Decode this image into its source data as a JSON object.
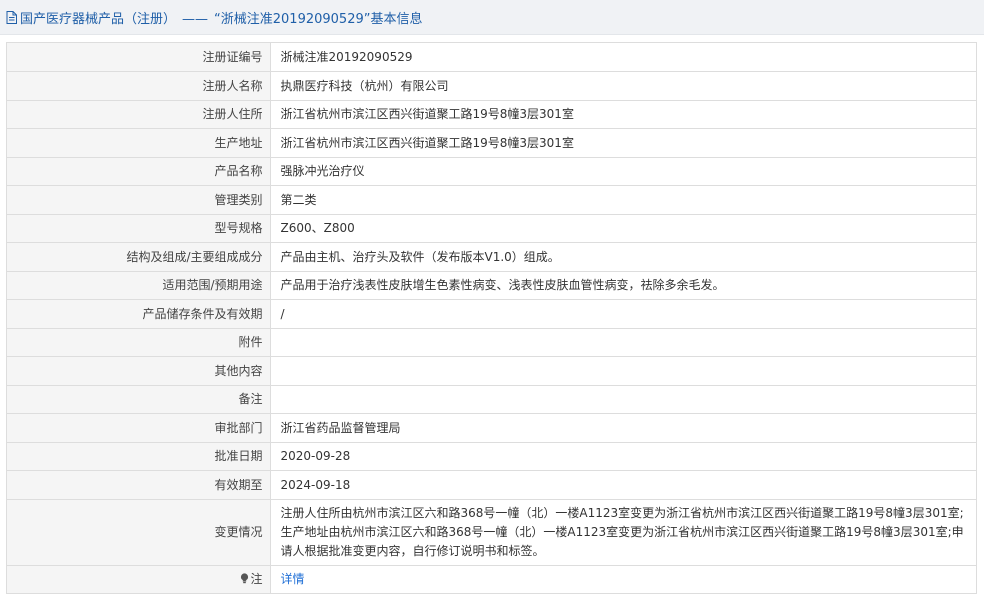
{
  "header": {
    "category": "国产医疗器械产品（注册）",
    "separator": "——",
    "record_title": "“浙械注准20192090529”基本信息"
  },
  "rows": [
    {
      "label": "注册证编号",
      "value": "浙械注准20192090529"
    },
    {
      "label": "注册人名称",
      "value": "执鼎医疗科技（杭州）有限公司"
    },
    {
      "label": "注册人住所",
      "value": "浙江省杭州市滨江区西兴街道聚工路19号8幢3层301室"
    },
    {
      "label": "生产地址",
      "value": "浙江省杭州市滨江区西兴街道聚工路19号8幢3层301室"
    },
    {
      "label": "产品名称",
      "value": "强脉冲光治疗仪"
    },
    {
      "label": "管理类别",
      "value": "第二类"
    },
    {
      "label": "型号规格",
      "value": "Z600、Z800"
    },
    {
      "label": "结构及组成/主要组成成分",
      "value": "产品由主机、治疗头及软件（发布版本V1.0）组成。"
    },
    {
      "label": "适用范围/预期用途",
      "value": "产品用于治疗浅表性皮肤增生色素性病变、浅表性皮肤血管性病变，祛除多余毛发。"
    },
    {
      "label": "产品储存条件及有效期",
      "value": "/"
    },
    {
      "label": "附件",
      "value": ""
    },
    {
      "label": "其他内容",
      "value": ""
    },
    {
      "label": "备注",
      "value": ""
    },
    {
      "label": "审批部门",
      "value": "浙江省药品监督管理局"
    },
    {
      "label": "批准日期",
      "value": "2020-09-28"
    },
    {
      "label": "有效期至",
      "value": "2024-09-18"
    },
    {
      "label": "变更情况",
      "value": "注册人住所由杭州市滨江区六和路368号一幢（北）一楼A1123室变更为浙江省杭州市滨江区西兴街道聚工路19号8幢3层301室;生产地址由杭州市滨江区六和路368号一幢（北）一楼A1123室变更为浙江省杭州市滨江区西兴街道聚工路19号8幢3层301室;申请人根据批准变更内容，自行修订说明书和标签。"
    }
  ],
  "note_row": {
    "label": "注",
    "icon": "bulb-icon",
    "link_text": "详情"
  },
  "colors": {
    "header_text": "#1f5fa8",
    "link": "#1f6fd6",
    "label_bg": "#f5f5f5",
    "border": "#dddddd"
  }
}
